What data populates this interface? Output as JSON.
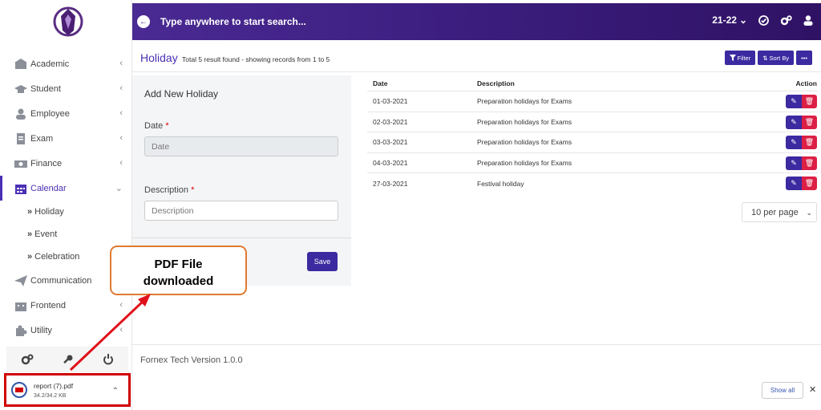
{
  "sidebar": {
    "items": [
      {
        "label": "Academic",
        "icon": "academic-icon"
      },
      {
        "label": "Student",
        "icon": "graduation-cap-icon"
      },
      {
        "label": "Employee",
        "icon": "user-icon"
      },
      {
        "label": "Exam",
        "icon": "document-icon"
      },
      {
        "label": "Finance",
        "icon": "money-icon"
      },
      {
        "label": "Calendar",
        "icon": "calendar-icon",
        "active": true
      },
      {
        "label": "Communication",
        "icon": "paper-plane-icon"
      },
      {
        "label": "Frontend",
        "icon": "building-icon"
      },
      {
        "label": "Utility",
        "icon": "puzzle-icon"
      }
    ],
    "subitems": [
      {
        "label": "Holiday"
      },
      {
        "label": "Event"
      },
      {
        "label": "Celebration"
      }
    ]
  },
  "topbar": {
    "search_placeholder": "Type anywhere to start search...",
    "session": "21-22"
  },
  "page": {
    "title": "Holiday",
    "subtitle": "Total 5 result found - showing records from 1 to 5",
    "filter_label": "Filter",
    "sort_label": "Sort By",
    "more_label": "•••"
  },
  "form": {
    "title": "Add New Holiday",
    "date_label": "Date",
    "date_placeholder": "Date",
    "description_label": "Description",
    "description_placeholder": "Description",
    "required_mark": "*",
    "save_label": "Save"
  },
  "table": {
    "headers": {
      "date": "Date",
      "description": "Description",
      "action": "Action"
    },
    "rows": [
      {
        "date": "01-03-2021",
        "description": "Preparation holidays for Exams"
      },
      {
        "date": "02-03-2021",
        "description": "Preparation holidays for Exams"
      },
      {
        "date": "03-03-2021",
        "description": "Preparation holidays for Exams"
      },
      {
        "date": "04-03-2021",
        "description": "Preparation holidays for Exams"
      },
      {
        "date": "27-03-2021",
        "description": "Festival holiday"
      }
    ],
    "per_page": "10 per page"
  },
  "footer": {
    "version": "Fornex Tech Version 1.0.0"
  },
  "download": {
    "file_name": "report (7).pdf",
    "file_size": "34.2/34.2 KB",
    "show_all": "Show all"
  },
  "callout": {
    "line1": "PDF File",
    "line2": "downloaded"
  },
  "colors": {
    "brand": "#3b2aa0",
    "topbar": "#3b1d7e",
    "delete": "#dc1f45",
    "annotation": "#d00000"
  }
}
